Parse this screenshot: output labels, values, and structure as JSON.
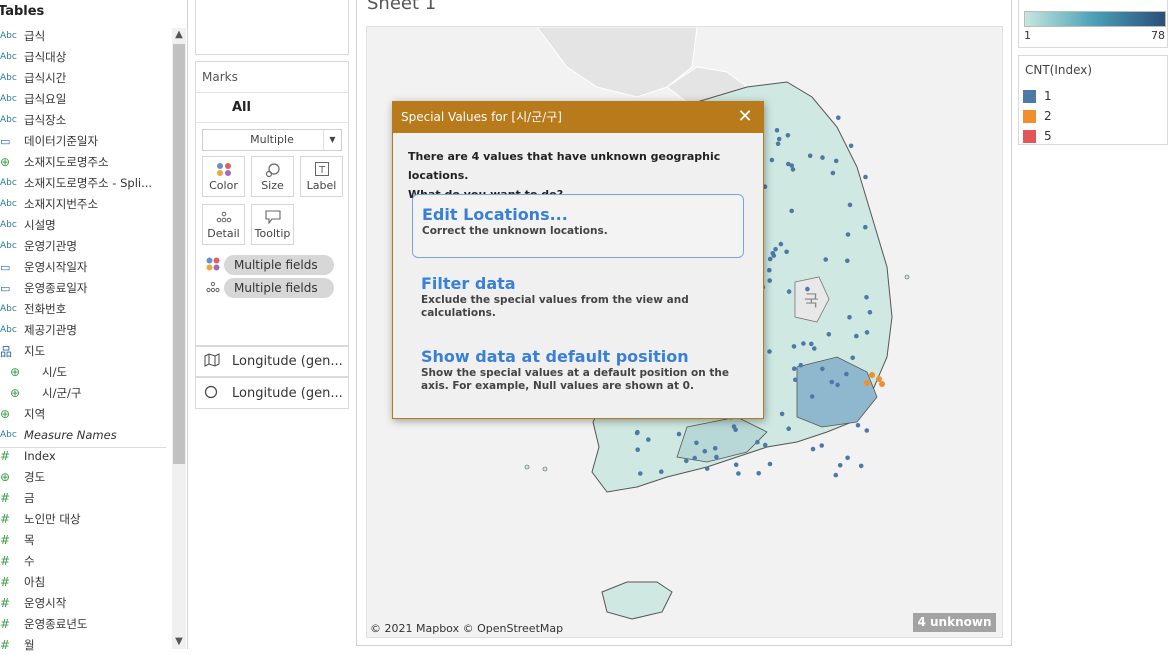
{
  "data_pane": {
    "header": "Tables",
    "fields": [
      {
        "icon": "Abc",
        "kind": "abc",
        "label": "급식",
        "indent": false,
        "italic": false
      },
      {
        "icon": "Abc",
        "kind": "abc",
        "label": "급식대상",
        "indent": false,
        "italic": false
      },
      {
        "icon": "Abc",
        "kind": "abc",
        "label": "급식시간",
        "indent": false,
        "italic": false
      },
      {
        "icon": "Abc",
        "kind": "abc",
        "label": "급식요일",
        "indent": false,
        "italic": false
      },
      {
        "icon": "Abc",
        "kind": "abc",
        "label": "급식장소",
        "indent": false,
        "italic": false
      },
      {
        "icon": "▭",
        "kind": "cal",
        "label": "데이터기준일자",
        "indent": false,
        "italic": false
      },
      {
        "icon": "⊕",
        "kind": "globe",
        "label": "소재지도로명주소",
        "indent": false,
        "italic": false
      },
      {
        "icon": "Abc",
        "kind": "abc",
        "label": "소재지도로명주소 - Spli...",
        "indent": false,
        "italic": false
      },
      {
        "icon": "Abc",
        "kind": "abc",
        "label": "소재지지번주소",
        "indent": false,
        "italic": false
      },
      {
        "icon": "Abc",
        "kind": "abc",
        "label": "시설명",
        "indent": false,
        "italic": false
      },
      {
        "icon": "Abc",
        "kind": "abc",
        "label": "운영기관명",
        "indent": false,
        "italic": false
      },
      {
        "icon": "▭",
        "kind": "cal",
        "label": "운영시작일자",
        "indent": false,
        "italic": false
      },
      {
        "icon": "▭",
        "kind": "cal",
        "label": "운영종료일자",
        "indent": false,
        "italic": false
      },
      {
        "icon": "Abc",
        "kind": "abc",
        "label": "전화번호",
        "indent": false,
        "italic": false
      },
      {
        "icon": "Abc",
        "kind": "abc",
        "label": "제공기관명",
        "indent": false,
        "italic": false
      },
      {
        "icon": "品",
        "kind": "hier",
        "label": "지도",
        "indent": false,
        "italic": false
      },
      {
        "icon": "⊕",
        "kind": "globe",
        "label": "시/도",
        "indent": true,
        "italic": false
      },
      {
        "icon": "⊕",
        "kind": "globe",
        "label": "시/군/구",
        "indent": true,
        "italic": false
      },
      {
        "icon": "⊕",
        "kind": "globe",
        "label": "지역",
        "indent": false,
        "italic": false
      },
      {
        "icon": "Abc",
        "kind": "abc",
        "label": "Measure Names",
        "indent": false,
        "italic": true
      },
      {
        "icon": "#",
        "kind": "num",
        "label": "Index",
        "indent": false,
        "italic": false
      },
      {
        "icon": "⊕",
        "kind": "globe",
        "label": "경도",
        "indent": false,
        "italic": false
      },
      {
        "icon": "#",
        "kind": "num",
        "label": "금",
        "indent": false,
        "italic": false
      },
      {
        "icon": "#",
        "kind": "num",
        "label": "노인만 대상",
        "indent": false,
        "italic": false
      },
      {
        "icon": "#",
        "kind": "num",
        "label": "목",
        "indent": false,
        "italic": false
      },
      {
        "icon": "#",
        "kind": "num",
        "label": "수",
        "indent": false,
        "italic": false
      },
      {
        "icon": "#",
        "kind": "num",
        "label": "아침",
        "indent": false,
        "italic": false
      },
      {
        "icon": "#",
        "kind": "num",
        "label": "운영시작",
        "indent": false,
        "italic": false
      },
      {
        "icon": "#",
        "kind": "num",
        "label": "운영종료년도",
        "indent": false,
        "italic": false
      },
      {
        "icon": "#",
        "kind": "num",
        "label": "월",
        "indent": false,
        "italic": false
      }
    ]
  },
  "marks": {
    "title": "Marks",
    "all_label": "All",
    "mark_type": "Multiple",
    "buttons": {
      "color": "Color",
      "size": "Size",
      "label": "Label",
      "detail": "Detail",
      "tooltip": "Tooltip"
    },
    "pills": [
      "Multiple fields",
      "Multiple fields"
    ]
  },
  "shelves": {
    "row1": "Longitude (gen...",
    "row2": "Longitude (gen..."
  },
  "sheet": {
    "title": "Sheet 1",
    "credit": "© 2021 Mapbox © OpenStreetMap",
    "unknown_badge": "4 unknown",
    "map_label": "국"
  },
  "legends": {
    "continuous": {
      "min": "1",
      "max": "78",
      "colors": [
        "#c6e6df",
        "#4a9fb5",
        "#2a4f7a"
      ]
    },
    "categorical": {
      "title": "CNT(Index)",
      "items": [
        {
          "label": "1",
          "color": "#4e79a7"
        },
        {
          "label": "2",
          "color": "#f28e2b"
        },
        {
          "label": "5",
          "color": "#e15759"
        }
      ]
    }
  },
  "dialog": {
    "title": "Special Values for [시/군/구]",
    "close_glyph": "✕",
    "message_line1": "There are 4 values that have unknown geographic locations.",
    "message_line2": "What do you want to do?",
    "options": [
      {
        "heading": "Edit Locations...",
        "desc": "Correct the unknown locations."
      },
      {
        "heading": "Filter data",
        "desc": "Exclude the special values from the view and calculations."
      },
      {
        "heading": "Show data at default position",
        "desc": "Show the special values at a default position on the axis. For example, Null values are shown at 0."
      }
    ],
    "accent_color": "#b87a1a",
    "link_color": "#3a7fd8"
  }
}
